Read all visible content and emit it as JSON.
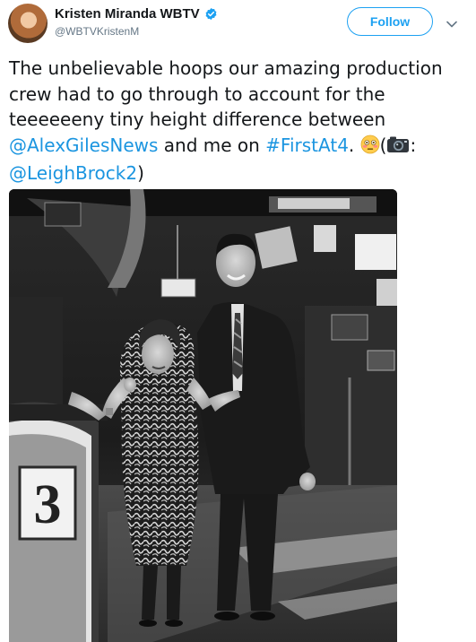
{
  "user": {
    "display_name": "Kristen Miranda WBTV",
    "handle": "@WBTVKristenM",
    "avatar_icon": "avatar-photo",
    "verified_icon": "verified-badge-icon"
  },
  "actions": {
    "follow_label": "Follow",
    "menu_icon": "chevron-down-icon"
  },
  "tweet": {
    "text_part1": "The unbelievable hoops our amazing production crew had to go through to account for the teeeeeeny tiny height difference between ",
    "mention1": "@AlexGilesNews",
    "text_part2": " and me on ",
    "hashtag": "#FirstAt4",
    "text_part3": ". ",
    "emoji1": "flushed-face-emoji",
    "text_part4": "(",
    "emoji2": "camera-emoji",
    "text_part5": ": ",
    "mention2": "@LeighBrock2",
    "text_part6": ")"
  },
  "media": {
    "photo_icon": "news-studio-photo",
    "logo_text": "3"
  },
  "colors": {
    "link": "#1b95e0",
    "follow_border": "#1da1f2",
    "handle_gray": "#657786",
    "text": "#14171a"
  }
}
